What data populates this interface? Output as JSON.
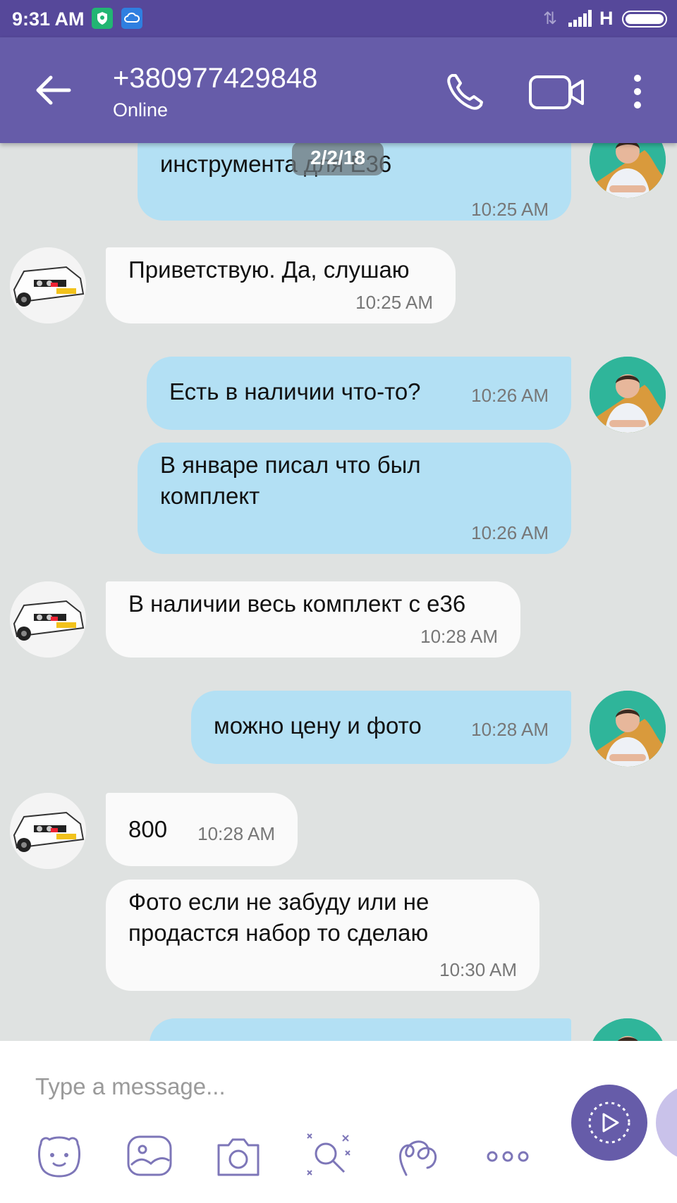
{
  "status_bar": {
    "time": "9:31 AM",
    "network_letter": "H",
    "network_arrows": "⇅"
  },
  "header": {
    "contact_name": "+380977429848",
    "contact_status": "Online",
    "icons": [
      "back-arrow-icon",
      "phone-icon",
      "video-icon",
      "more-vertical-icon"
    ]
  },
  "date_chip": "2/2/18",
  "messages": [
    {
      "dir": "out",
      "text": "инструмента для E36",
      "time": "10:25 AM"
    },
    {
      "dir": "in",
      "text": "Приветствую. Да, слушаю",
      "time": "10:25 AM"
    },
    {
      "dir": "out",
      "text": "Есть в наличии что-то?",
      "time": "10:26 AM"
    },
    {
      "dir": "out",
      "text": "В январе писал что был комплект",
      "time": "10:26 AM"
    },
    {
      "dir": "in",
      "text": "В наличии весь комплект с е36",
      "time": "10:28 AM"
    },
    {
      "dir": "out",
      "text": "можно цену и фото",
      "time": "10:28 AM"
    },
    {
      "dir": "in",
      "text": "800",
      "time": "10:28 AM"
    },
    {
      "dir": "in",
      "text": "Фото если не забуду или не продастся набор то сделаю",
      "time": "10:30 AM"
    }
  ],
  "composer": {
    "placeholder": "Type a message...",
    "tools": [
      "sticker-icon",
      "gallery-icon",
      "camera-icon",
      "doodle-icon",
      "gif-icon",
      "more-horizontal-icon"
    ],
    "send_icon": "send-icon"
  },
  "colors": {
    "header": "#665ca9",
    "status_bar": "#56489a",
    "outgoing_bubble": "#b3e0f4",
    "incoming_bubble": "#fafafa",
    "background": "#dfe2e1"
  }
}
